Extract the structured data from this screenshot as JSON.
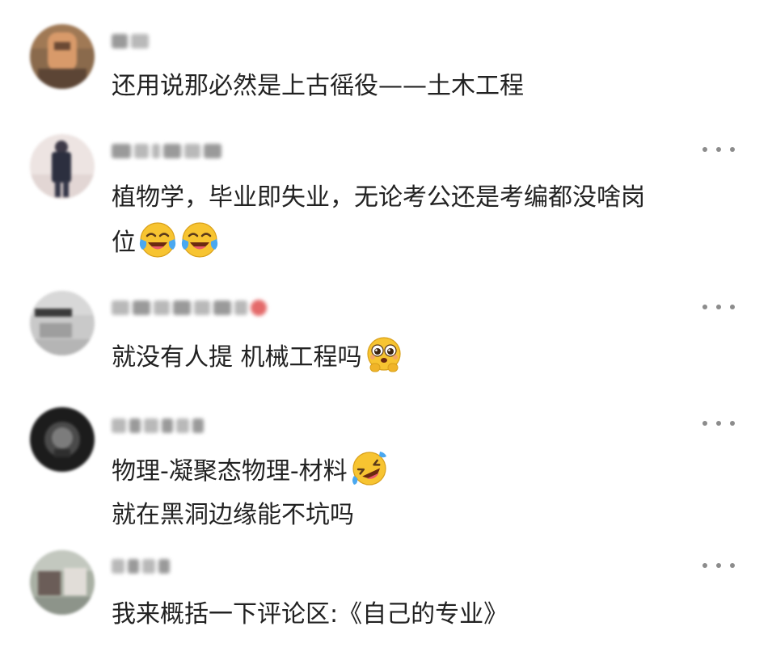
{
  "comments": [
    {
      "id": "c1",
      "username": "",
      "lines": [
        "还用说那必然是上古徭役——土木工程"
      ],
      "emojis": [],
      "has_more": false
    },
    {
      "id": "c2",
      "username": "",
      "lines": [
        "植物学，毕业即失业，无论考公还是考编都没啥岗",
        "位"
      ],
      "emojis": [
        "crying-laughing-emoji",
        "crying-laughing-emoji"
      ],
      "has_more": true
    },
    {
      "id": "c3",
      "username": "",
      "lines": [
        "就没有人提 机械工程吗"
      ],
      "emojis": [
        "pleading-face-emoji"
      ],
      "has_more": true
    },
    {
      "id": "c4",
      "username": "",
      "lines": [
        "物理-凝聚态物理-材料",
        "就在黑洞边缘能不坑吗"
      ],
      "emojis": [
        "rolling-laughing-emoji"
      ],
      "has_more": true
    },
    {
      "id": "c5",
      "username": "",
      "lines": [
        "我来概括一下评论区:《自己的专业》"
      ],
      "emojis": [],
      "has_more": true
    }
  ],
  "icons": {
    "more": "more-icon",
    "avatar": "avatar"
  },
  "colors": {
    "text": "#222222",
    "more_dots": "#8c8c8c",
    "emoji_face": "#f7c431",
    "emoji_tear": "#4aa8f0",
    "background": "#ffffff"
  }
}
